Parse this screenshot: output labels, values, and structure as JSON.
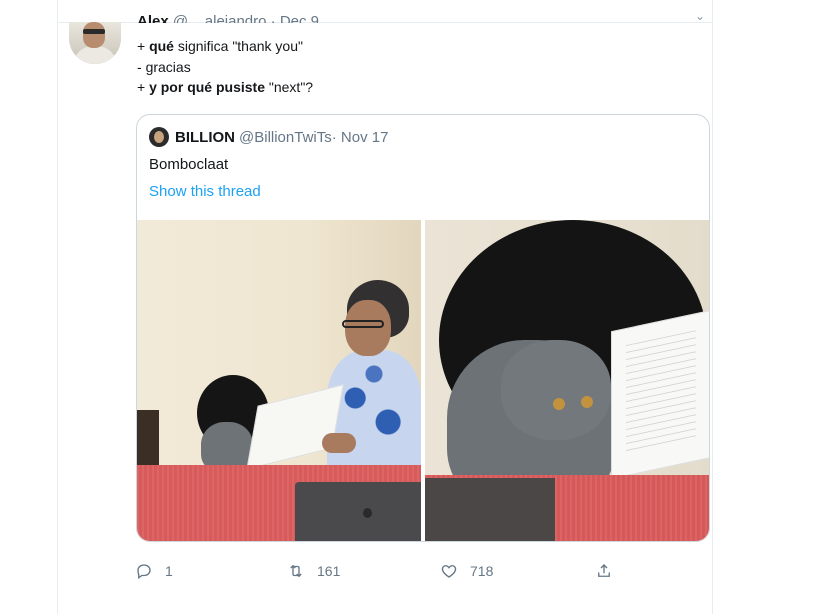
{
  "tweet": {
    "author_name": "Alex",
    "author_handle": "@__alejandro",
    "sep": "·",
    "date": "Dec 9",
    "lines": [
      {
        "prefix": "+ ",
        "bold": "qué",
        "rest": " significa \"thank you\""
      },
      {
        "prefix": "- ",
        "bold": "",
        "rest": "gracias"
      },
      {
        "prefix": "+ ",
        "bold": "y por qué pusiste",
        "rest": " \"next\"?"
      }
    ]
  },
  "quoted": {
    "name": "BILLION",
    "handle": "@BillionTwiTs",
    "date": "· Nov 17",
    "text": "Bomboclaat",
    "link": "Show this thread"
  },
  "actions": {
    "reply_count": "1",
    "retweet_count": "161",
    "like_count": "718"
  },
  "icons": [
    "caret-down-icon",
    "reply-icon",
    "retweet-icon",
    "like-icon",
    "share-icon"
  ],
  "colors": {
    "link": "#1da1f2",
    "muted": "#657786",
    "border": "#ccd6dd"
  }
}
